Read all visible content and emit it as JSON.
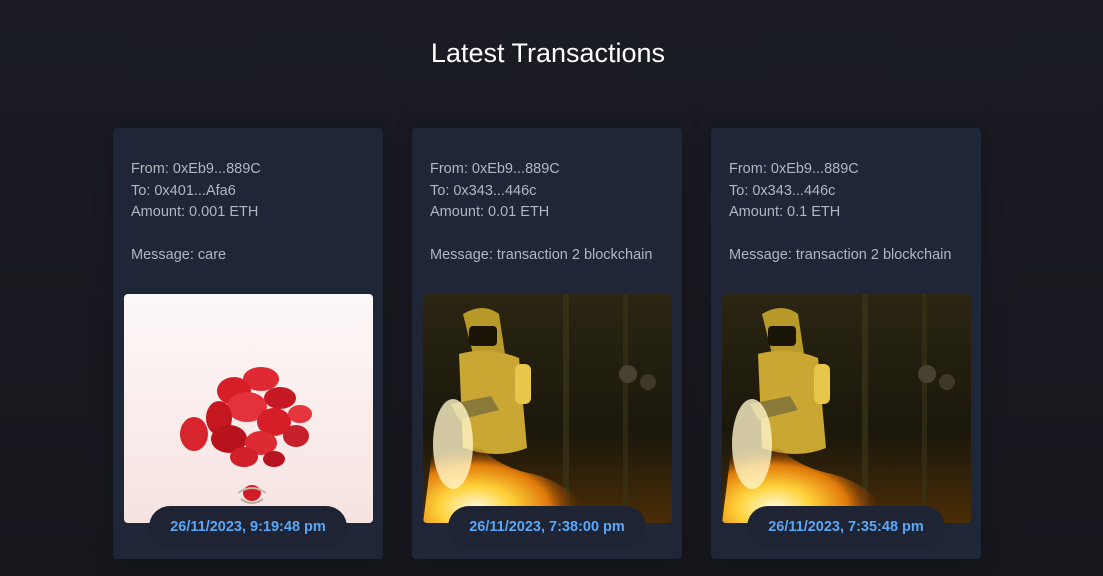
{
  "page": {
    "title": "Latest Transactions"
  },
  "transactions": [
    {
      "from": "From: 0xEb9...889C",
      "to": "To: 0x401...Afa6",
      "amount": "Amount: 0.001 ETH",
      "message": "Message: care",
      "image": "rose-petals-image",
      "timestamp": "26/11/2023, 9:19:48 pm"
    },
    {
      "from": "From: 0xEb9...889C",
      "to": "To: 0x343...446c",
      "amount": "Amount: 0.01 ETH",
      "message": "Message: transaction 2 blockchain",
      "image": "flamethrower-suit-image",
      "timestamp": "26/11/2023, 7:38:00 pm"
    },
    {
      "from": "From: 0xEb9...889C",
      "to": "To: 0x343...446c",
      "amount": "Amount: 0.1 ETH",
      "message": "Message: transaction 2 blockchain",
      "image": "flamethrower-suit-image",
      "timestamp": "26/11/2023, 7:35:48 pm"
    }
  ],
  "colors": {
    "background": "#17181f",
    "card": "#1f2637",
    "text": "#b1b6c1",
    "accent": "#5aa6f7"
  }
}
